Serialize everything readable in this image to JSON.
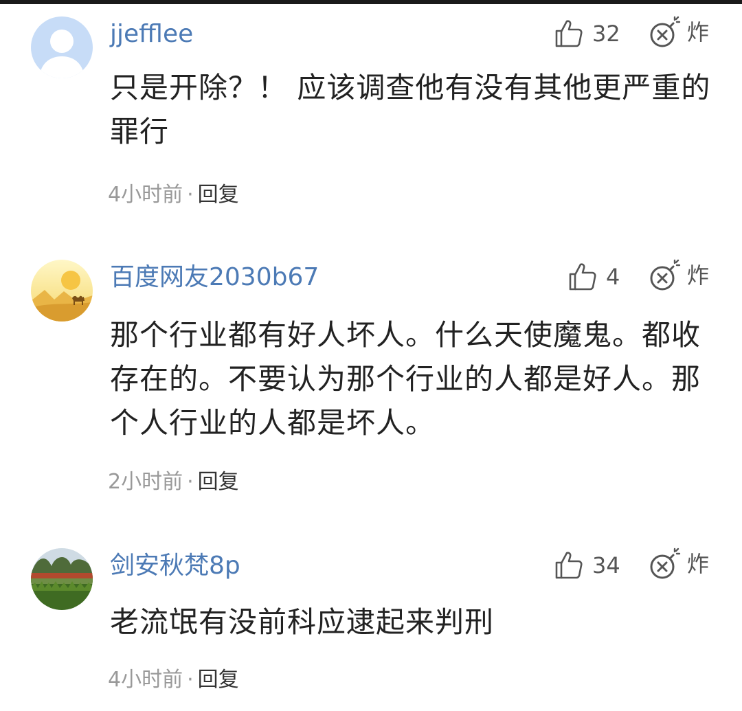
{
  "comments": [
    {
      "username": "jjefflee",
      "likes": "32",
      "bomb_label": "炸",
      "content": "只是开除？！ 应该调查他有没有其他更严重的罪行",
      "time": "4小时前",
      "separator": "·",
      "reply_label": "回复",
      "avatar_icon": "default-user-avatar"
    },
    {
      "username": "百度网友2030b67",
      "likes": "4",
      "bomb_label": "炸",
      "content": "那个行业都有好人坏人。什么天使魔鬼。都收存在的。不要认为那个行业的人都是好人。那个人行业的人都是坏人。",
      "time": "2小时前",
      "separator": "·",
      "reply_label": "回复",
      "avatar_icon": "desert-camel-avatar"
    },
    {
      "username": "剑安秋梵8p",
      "likes": "34",
      "bomb_label": "炸",
      "content": "老流氓有没前科应逮起来判刑",
      "time": "4小时前",
      "separator": "·",
      "reply_label": "回复",
      "avatar_icon": "garden-photo-avatar"
    }
  ],
  "colors": {
    "username": "#4c7ab5",
    "content": "#222222",
    "meta": "#999999",
    "icon": "#555555"
  }
}
